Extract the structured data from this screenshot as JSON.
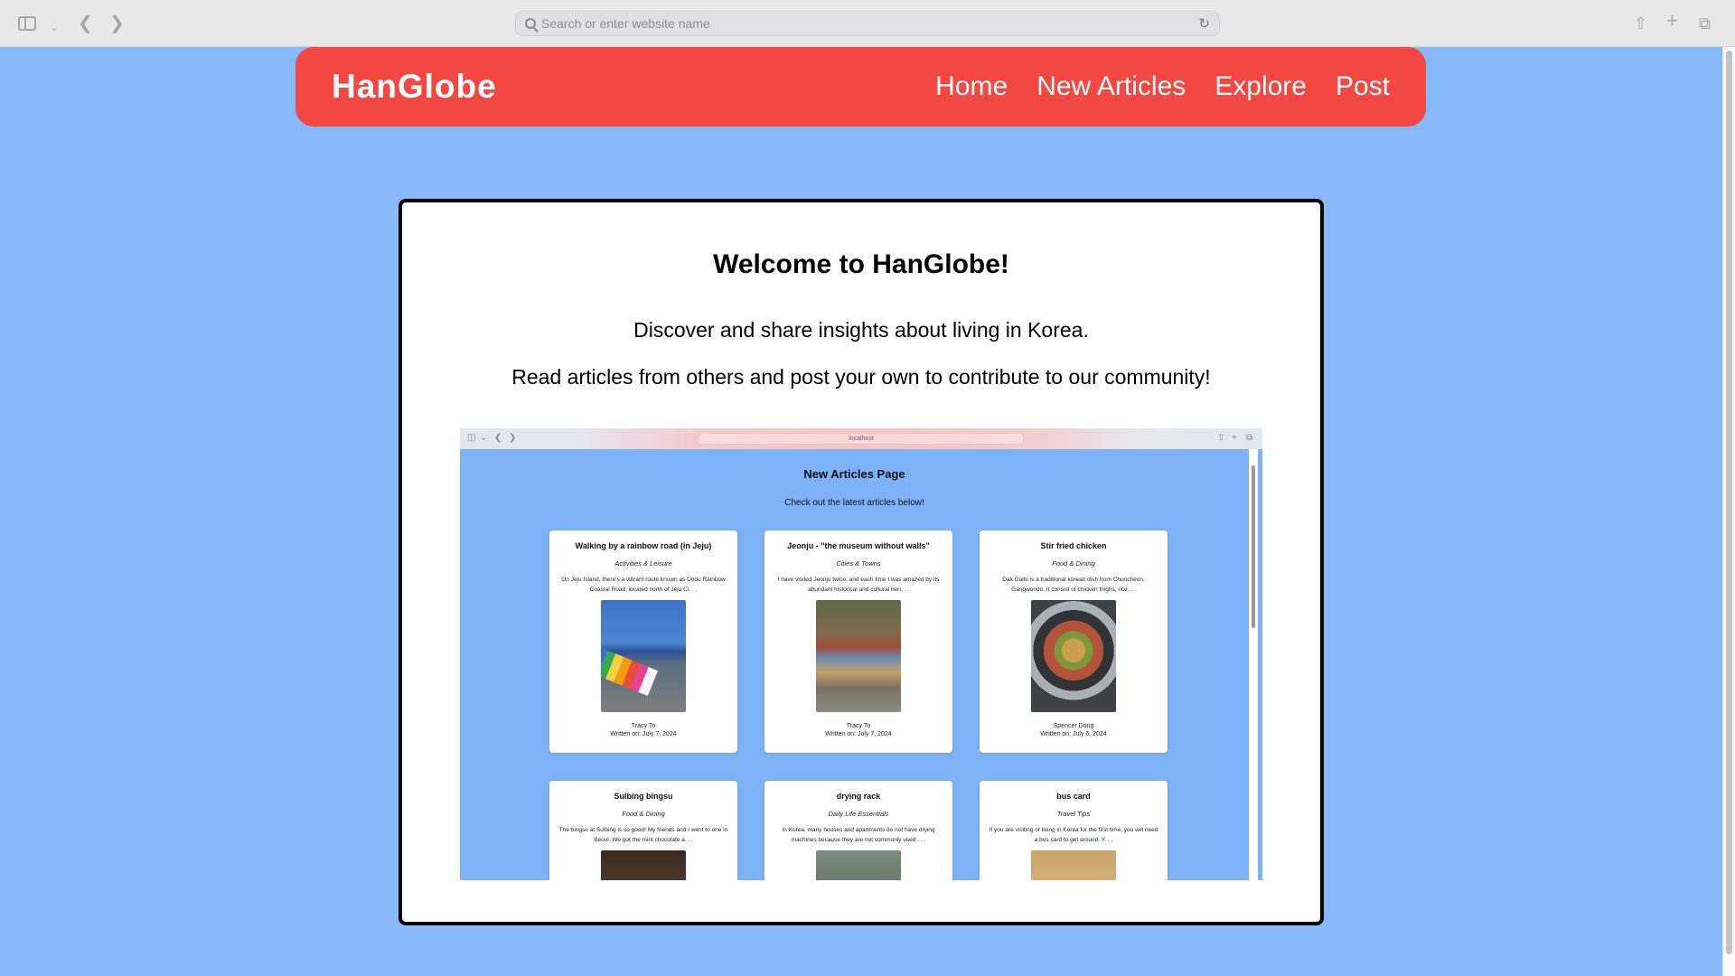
{
  "browser": {
    "url_placeholder": "Search or enter website name"
  },
  "site": {
    "brand": "HanGlobe",
    "nav": [
      "Home",
      "New Articles",
      "Explore",
      "Post"
    ],
    "nav_color": "#f24841",
    "background_color": "#86b8fa"
  },
  "hero": {
    "title": "Welcome to HanGlobe!",
    "line1": "Discover and share insights about living in Korea.",
    "line2": "Read articles from others and post your own to contribute to our community!"
  },
  "preview": {
    "url": "localhost",
    "page_title": "New Articles Page",
    "page_subtitle": "Check out the latest articles below!",
    "articles": [
      {
        "title": "Walking by a rainbow road (in Jeju)",
        "category": "Activities & Leisure",
        "excerpt": "On Jeju Island, there's a vibrant route known as Dodu Rainbow Coastal Road, located north of Jeju Ci. . .",
        "author": "Tracy To",
        "date": "Written on: July 7, 2024"
      },
      {
        "title": "Jeonju - \"the museum without walls\"",
        "category": "Cities & Towns",
        "excerpt": "I have visited Jeonju twice, and each time I was amazed by its abundant historical and cultural heri. . .",
        "author": "Tracy To",
        "date": "Written on: July 7, 2024"
      },
      {
        "title": "Stir fried chicken",
        "category": "Food & Dining",
        "excerpt": "Dak Galbi is a traditional korean dish from Chuncheon, Gangwondo. It consist of chicken thighs, rice. . .",
        "author": "Spencer Dong",
        "date": "Written on: July 6, 2024"
      },
      {
        "title": "Sulbing bingsu",
        "category": "Food & Dining",
        "excerpt": "The bingsu at Sulbing is so good! My friends and I went to one in Seoul. We got the mint chocolate a. . ."
      },
      {
        "title": "drying rack",
        "category": "Daily Life Essentials",
        "excerpt": "In Korea, many houses and apartments do not have drying machines because they are not commonly used . . ."
      },
      {
        "title": "bus card",
        "category": "Travel Tips",
        "excerpt": "If you are visiting or living in Korea for the first time, you will need a bus card to get around. Y. . ."
      }
    ]
  }
}
